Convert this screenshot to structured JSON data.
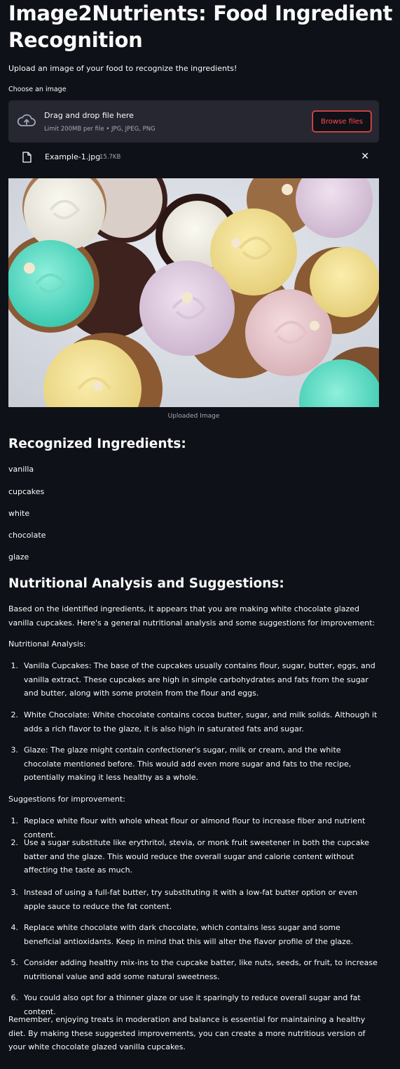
{
  "app": {
    "title": "Image2Nutrients: Food Ingredient Recognition",
    "subtitle": "Upload an image of your food to recognize the ingredients!"
  },
  "uploader": {
    "label": "Choose an image",
    "drop_text": "Drag and drop file here",
    "limit_text": "Limit 200MB per file • JPG, JPEG, PNG",
    "browse_label": "Browse files",
    "file_name": "Example-1.jpg",
    "file_size": "15.7KB",
    "close_symbol": "✕"
  },
  "image": {
    "caption": "Uploaded Image"
  },
  "ingredients": {
    "heading": "Recognized Ingredients:",
    "items": [
      "vanilla",
      "cupcakes",
      "white",
      "chocolate",
      "glaze"
    ]
  },
  "analysis": {
    "heading": "Nutritional Analysis and Suggestions:",
    "intro": "Based on the identified ingredients, it appears that you are making white chocolate glazed vanilla cupcakes. Here's a general nutritional analysis and some suggestions for improvement:",
    "section1_label": "Nutritional Analysis:",
    "section1_items": [
      "Vanilla Cupcakes: The base of the cupcakes usually contains flour, sugar, butter, eggs, and vanilla extract. These cupcakes are high in simple carbohydrates and fats from the sugar and butter, along with some protein from the flour and eggs.",
      "White Chocolate: White chocolate contains cocoa butter, sugar, and milk solids. Although it adds a rich flavor to the glaze, it is also high in saturated fats and sugar.",
      "Glaze: The glaze might contain confectioner's sugar, milk or cream, and the white chocolate mentioned before. This would add even more sugar and fats to the recipe, potentially making it less healthy as a whole."
    ],
    "section2_label": "Suggestions for improvement:",
    "section2_items": [
      "Replace white flour with whole wheat flour or almond flour to increase fiber and nutrient content.",
      "Use a sugar substitute like erythritol, stevia, or monk fruit sweetener in both the cupcake batter and the glaze. This would reduce the overall sugar and calorie content without affecting the taste as much.",
      "Instead of using a full-fat butter, try substituting it with a low-fat butter option or even apple sauce to reduce the fat content.",
      "Replace white chocolate with dark chocolate, which contains less sugar and some beneficial antioxidants. Keep in mind that this will alter the flavor profile of the glaze.",
      "Consider adding healthy mix-ins to the cupcake batter, like nuts, seeds, or fruit, to increase nutritional value and add some natural sweetness.",
      "You could also opt for a thinner glaze or use it sparingly to reduce overall sugar and fat content."
    ],
    "closing": "Remember, enjoying treats in moderation and balance is essential for maintaining a healthy diet. By making these suggested improvements, you can create a more nutritious version of your white chocolate glazed vanilla cupcakes."
  },
  "numbers": {
    "n1": "1.",
    "n2": "2.",
    "n3": "3.",
    "n4": "4.",
    "n5": "5.",
    "n6": "6."
  },
  "colors": {
    "background": "#0e1117",
    "panel": "#262730",
    "accent": "#ff4b4b",
    "text": "#fafafa",
    "muted": "#a3a8b8"
  },
  "icons": {
    "upload": "cloud-upload-icon",
    "file": "file-icon",
    "close": "close-icon"
  }
}
